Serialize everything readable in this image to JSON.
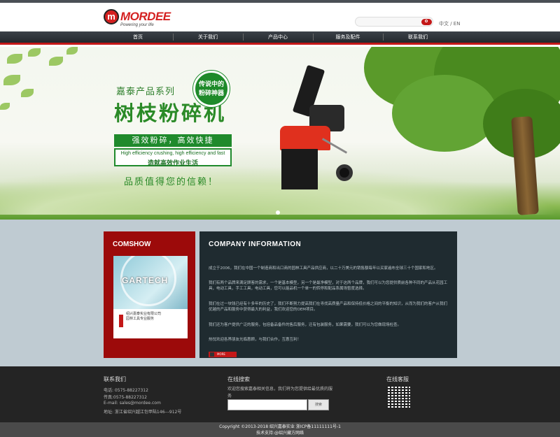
{
  "header": {
    "logo_mark": "m",
    "logo_text": "MORDEE",
    "logo_tagline": "Powering your life",
    "search_placeholder": "",
    "language": "中文 / EN"
  },
  "nav": {
    "items": [
      "首页",
      "关于我们",
      "产品中心",
      "服务及配件",
      "联系我们"
    ]
  },
  "banner": {
    "series": "嘉泰产品系列",
    "title": "树枝粉碎机",
    "badge_line1": "传说中的",
    "badge_line2": "粉碎神器",
    "slogan": "强效粉碎，高效快捷",
    "english": "High efficiency crushing, high efficiency and fast",
    "subslogan": "造就高效作业生活",
    "trust": "品质值得您的信赖！"
  },
  "comshow": {
    "title": "COMSHOW",
    "book_title": "GARTECH",
    "book_cn_line1": "绍兴嘉泰实业有限公司",
    "book_cn_line2": "园林工具专业服务"
  },
  "company": {
    "title": "COMPANY  INFORMATION",
    "paragraphs": [
      "成立于2006，我们在中国一个制造商和出口商的园林工具产品供应商，以二十万美元的销售额每年以买家遍布全球三十个国家和地区。",
      "我们有两个品牌来满足顾客的需求，一个是基本模型，另一个是最净模型，对于这两个品牌，我们可以为您提供质前各种不同的产品从花园工具，电动工具，手工工具，电动工具，您可以能品机一个单一的转停和配品系属场暂度选择。",
      "我们在过一块钱已经有十多年的历史了，我们不断努力提高我们在寻找高质量产品和保持低价格之间的平衡的知识，从而为我们的客户从我们优越的产品和服务中获得最大的利益，我们欢迎您的OEM项目。",
      "我们还为客户提供广泛的服务，包括备品备件的售后服务，迁有包装服务，如果需要，我们可以为您做现场检查。",
      "热忱欢迎各界朋友光临惠顾，与我们合作，互惠互利！"
    ],
    "more": "MORE"
  },
  "footer": {
    "contact_title": "联系我们",
    "contact_lines": [
      "电话: 0575-88227312",
      "传真:0575-88227312",
      "E-mail: sales@mordee.com",
      "地址: 浙江省绍兴越江包甲陆146---912号"
    ],
    "search_title": "在线搜索",
    "search_desc_1": "欢迎您搜索嘉泰相关信息，我们将为您提供给最优质的服",
    "search_desc_2": "务",
    "search_button": "搜索",
    "service_title": "在线客服",
    "copyright_1": "Copyright ©2013-2018 绍兴嘉泰实业 浙ICP备11111111号-1",
    "copyright_2": "技术支持:@绍兴藏方网络"
  }
}
